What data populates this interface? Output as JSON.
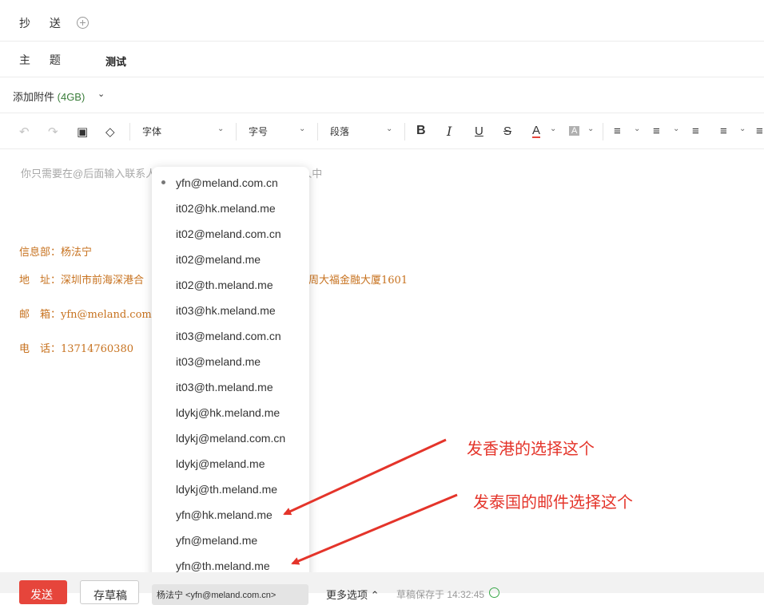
{
  "cc": {
    "label": "抄 送"
  },
  "subject": {
    "label": "主 题",
    "value": "测试"
  },
  "attachment": {
    "label": "添加附件",
    "size": "(4GB)"
  },
  "toolbar": {
    "font_label": "字体",
    "size_label": "字号",
    "paragraph_label": "段落",
    "bold": "B",
    "italic": "I",
    "underline": "U",
    "strike": "S",
    "font_color": "A",
    "bg_color": "A"
  },
  "editor": {
    "placeholder": "你只需要在@后面输入联系人，系统就会自动将他加入到收件人中",
    "signature": {
      "dept": "信息部：杨法宁",
      "address_head": "地　址：深圳市前海深港合",
      "address_tail": "周大福金融大厦1601",
      "email": "邮　箱：yfn@meland.com.cn",
      "phone": "电　话：13714760380"
    }
  },
  "dropdown": {
    "items": [
      "yfn@meland.com.cn",
      "it02@hk.meland.me",
      "it02@meland.com.cn",
      "it02@meland.me",
      "it02@th.meland.me",
      "it03@hk.meland.me",
      "it03@meland.com.cn",
      "it03@meland.me",
      "it03@th.meland.me",
      "ldykj@hk.meland.me",
      "ldykj@meland.com.cn",
      "ldykj@meland.me",
      "ldykj@th.meland.me",
      "yfn@hk.meland.me",
      "yfn@meland.me",
      "yfn@th.meland.me"
    ]
  },
  "annotations": {
    "hk": "发香港的选择这个",
    "th": "发泰国的邮件选择这个",
    "color": "#e4342a"
  },
  "footer": {
    "send": "发送",
    "draft": "存草稿",
    "sender": "杨法宁 <yfn@meland.com.cn>",
    "more": "更多选项",
    "status": "草稿保存于 14:32:45"
  }
}
